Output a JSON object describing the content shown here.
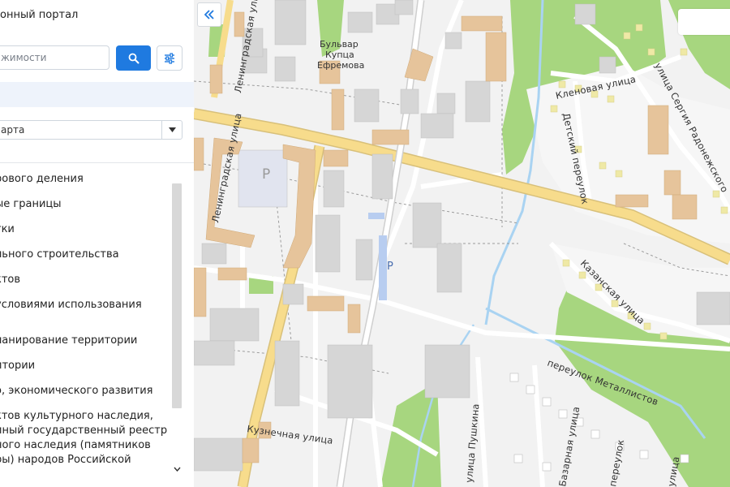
{
  "sidebar": {
    "title": "онный портал",
    "search_placeholder": "жимости",
    "select_value": "арта",
    "layers": [
      "рового деления",
      "ые границы",
      "тки",
      "льного строительства",
      "ктов",
      "условиями использования",
      "",
      "ланирование территории",
      "итории",
      "о, экономического развития",
      "ктов культурного наследия,\nиный государственный реестр\nного наследия (памятников\nры) народов Российской"
    ]
  },
  "icons": {
    "search": "search-icon",
    "filter": "sliders-icon",
    "dropdown": "chevron-down-icon",
    "collapse": "double-chevron-left-icon",
    "scroll": "chevron-down-icon"
  },
  "colors": {
    "accent": "#1f7ae0",
    "road_major": "#f7dc8c",
    "building": "#e6c49b",
    "park": "#9fd07a",
    "water": "#a9d3f2"
  },
  "map": {
    "labels": {
      "boulevard": [
        "Бульвар",
        "Купца",
        "Ефремова"
      ],
      "parking": "P",
      "streets": {
        "leningradskaya_top": "Ленинградская улица",
        "leningradskaya_left": "Ленинградская улица",
        "klenovaya": "Кленовая улица",
        "radonezhskogo": "улица Сергия Радонежского",
        "detsky": "Детский переулок",
        "kazanskaya": "Казанская улица",
        "kuznechnaya": "Кузнечная улица",
        "pushkina": "улица Пушкина",
        "metallistov": "переулок Металлистов",
        "bazarnaya": "Базарная улица",
        "pereulok": "переулок",
        "ulitsa": "улица"
      }
    }
  }
}
